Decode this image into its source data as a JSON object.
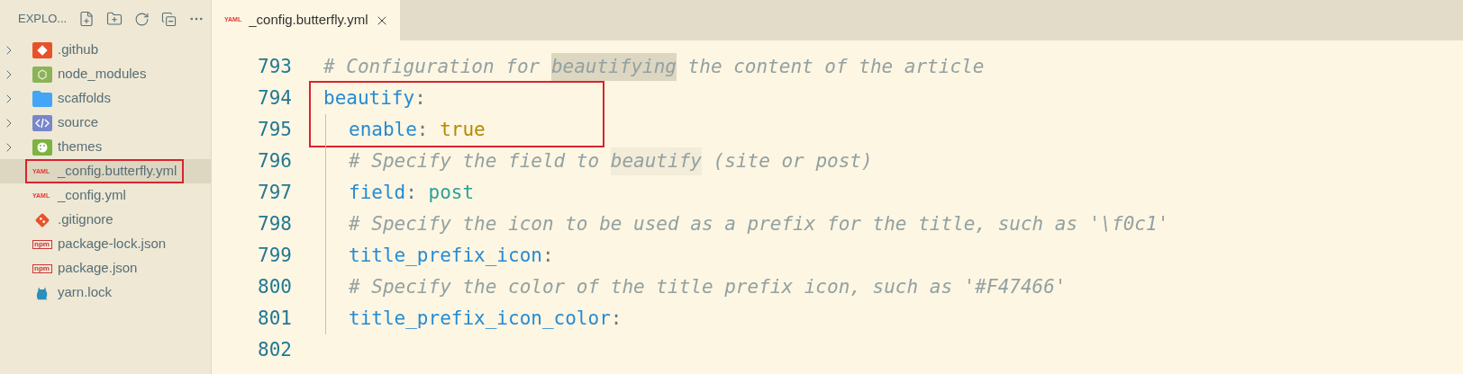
{
  "explorer": {
    "title": "EXPLO...",
    "items": [
      {
        "kind": "folder",
        "name": ".github",
        "expanded": false,
        "selected": false,
        "outlined": false
      },
      {
        "kind": "folder",
        "name": "node_modules",
        "expanded": false,
        "selected": false,
        "outlined": false
      },
      {
        "kind": "folder",
        "name": "scaffolds",
        "expanded": false,
        "selected": false,
        "outlined": false
      },
      {
        "kind": "folder",
        "name": "source",
        "expanded": false,
        "selected": false,
        "outlined": false
      },
      {
        "kind": "folder",
        "name": "themes",
        "expanded": false,
        "selected": false,
        "outlined": false
      },
      {
        "kind": "file",
        "badge": "YAML",
        "name": "_config.butterfly.yml",
        "selected": true,
        "outlined": true
      },
      {
        "kind": "file",
        "badge": "YAML",
        "name": "_config.yml",
        "selected": false,
        "outlined": false
      },
      {
        "kind": "file",
        "name": ".gitignore",
        "selected": false,
        "outlined": false
      },
      {
        "kind": "file",
        "badge": "npm",
        "name": "package-lock.json",
        "selected": false,
        "outlined": false
      },
      {
        "kind": "file",
        "badge": "npm",
        "name": "package.json",
        "selected": false,
        "outlined": false
      },
      {
        "kind": "file",
        "name": "yarn.lock",
        "selected": false,
        "outlined": false
      }
    ]
  },
  "tabs": [
    {
      "badge": "YAML",
      "label": "_config.butterfly.yml",
      "selected": true
    }
  ],
  "editor": {
    "blocks": [
      {
        "outlined": false,
        "lines": [
          {
            "number": "793",
            "indented": false,
            "tokens": [
              {
                "kind": "comment",
                "text": "# Configuration for "
              },
              {
                "kind": "match",
                "text": "beautifying"
              },
              {
                "kind": "comment",
                "text": " the content of the article"
              }
            ]
          }
        ]
      },
      {
        "outlined": true,
        "lines": [
          {
            "number": "794",
            "indented": false,
            "tokens": [
              {
                "kind": "key",
                "text": "beautify"
              },
              {
                "kind": "punct",
                "text": ":"
              }
            ]
          },
          {
            "number": "795",
            "indented": true,
            "tokens": [
              {
                "kind": "key",
                "text": "enable"
              },
              {
                "kind": "punct",
                "text": ": "
              },
              {
                "kind": "bool",
                "text": "true"
              }
            ]
          }
        ]
      },
      {
        "outlined": false,
        "lines": [
          {
            "number": "796",
            "indented": true,
            "tokens": [
              {
                "kind": "comment",
                "text": "# Specify the field to "
              },
              {
                "kind": "occurrence",
                "text": "beautify"
              },
              {
                "kind": "comment",
                "text": " (site or post)"
              }
            ]
          },
          {
            "number": "797",
            "indented": true,
            "tokens": [
              {
                "kind": "key",
                "text": "field"
              },
              {
                "kind": "punct",
                "text": ": "
              },
              {
                "kind": "string",
                "text": "post"
              }
            ]
          },
          {
            "number": "798",
            "indented": true,
            "tokens": [
              {
                "kind": "comment",
                "text": "# Specify the icon to be used as a prefix for the title, such as '\\f0c1'"
              }
            ]
          },
          {
            "number": "799",
            "indented": true,
            "tokens": [
              {
                "kind": "key",
                "text": "title_prefix_icon"
              },
              {
                "kind": "punct",
                "text": ":"
              }
            ]
          },
          {
            "number": "800",
            "indented": true,
            "tokens": [
              {
                "kind": "comment",
                "text": "# Specify the color of the title prefix icon, such as '#F47466'"
              }
            ]
          },
          {
            "number": "801",
            "indented": true,
            "tokens": [
              {
                "kind": "key",
                "text": "title_prefix_icon_color"
              },
              {
                "kind": "punct",
                "text": ":"
              }
            ]
          },
          {
            "number": "802",
            "indented": false
          }
        ]
      }
    ]
  }
}
